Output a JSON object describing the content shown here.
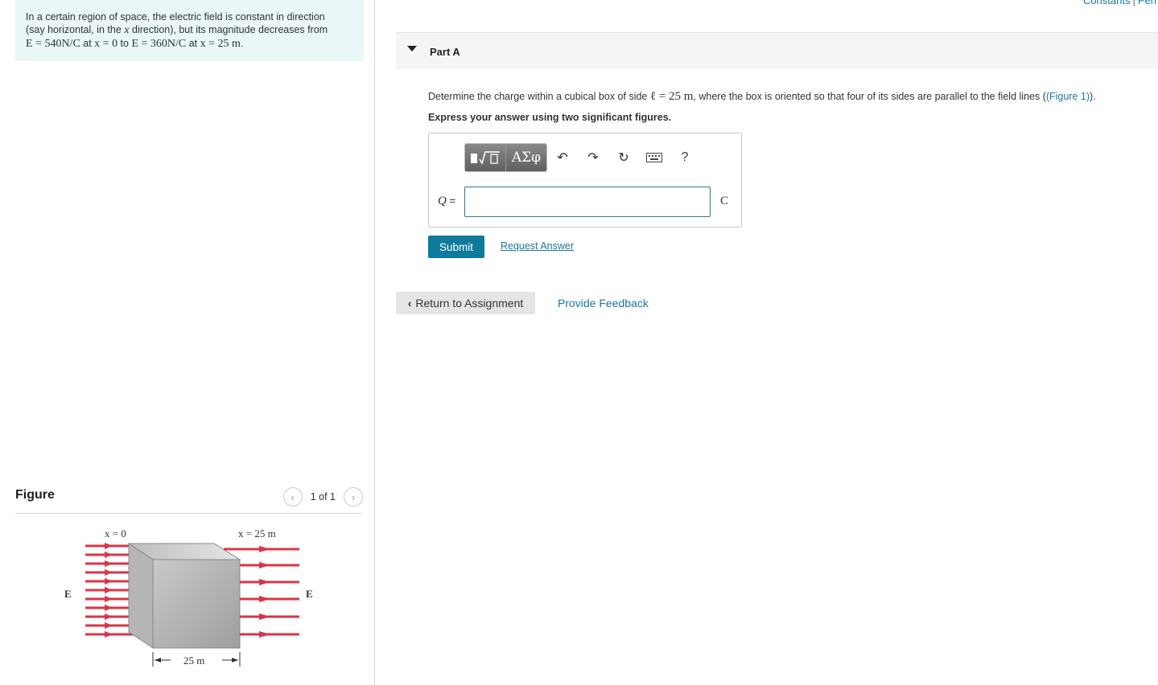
{
  "header": {
    "constants_label": "Constants",
    "separator": "|",
    "periodic_label": "Peri"
  },
  "intro": {
    "line1": "In a certain region of space, the electric field is constant in direction",
    "line2_a": "(say horizontal, in the ",
    "line2_var": "x",
    "line2_b": " direction), but its magnitude decreases from",
    "e1": "E = 540N/C",
    "at1": " at ",
    "x1": "x = 0",
    "to": " to ",
    "e2": "E = 360N/C",
    "at2": " at ",
    "x2": "x = 25 m",
    "end": "."
  },
  "figure": {
    "title": "Figure",
    "pager": "1 of 1",
    "prev_icon": "chevron-left-icon",
    "next_icon": "chevron-right-icon",
    "label_x0": "x = 0",
    "label_x25": "x = 25 m",
    "label_e_left": "E",
    "label_e_right": "E",
    "label_width": "25 m",
    "field_color": "#d8364a"
  },
  "part": {
    "title": "Part A",
    "question_a": "Determine the charge within a cubical box of side ",
    "question_math": "ℓ = 25 m",
    "question_b": ", where the box is oriented so that four of its sides are parallel to the field lines (",
    "figure_link": "(Figure 1)",
    "question_c": ").",
    "instruction": "Express your answer using two significant figures."
  },
  "toolbar": {
    "templates_icon": "templates-icon",
    "greek_label": "ΑΣφ",
    "undo_icon": "undo-icon",
    "redo_icon": "redo-icon",
    "reset_icon": "reset-icon",
    "keyboard_icon": "keyboard-icon",
    "help_label": "?"
  },
  "answer": {
    "variable": "Q",
    "equals": " =",
    "value": "",
    "unit": "C"
  },
  "actions": {
    "submit_label": "Submit",
    "request_label": "Request Answer",
    "return_label": "Return to Assignment",
    "feedback_label": "Provide Feedback"
  },
  "colors": {
    "accent": "#0f7b9c",
    "link": "#1976a9",
    "intro_bg": "#e9f7f8"
  }
}
